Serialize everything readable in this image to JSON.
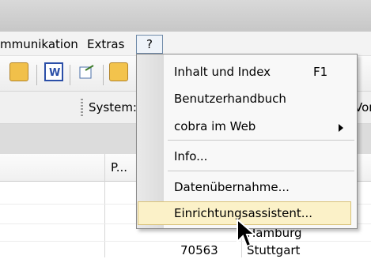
{
  "menubar": {
    "items": [
      "mmunikation",
      "Extras",
      "?"
    ]
  },
  "toolbar": {
    "system_label": "System:",
    "vor_label": "Vorl"
  },
  "grid": {
    "column_header": "P...",
    "rows": [
      {
        "plz": "",
        "ort": "Hamburg"
      },
      {
        "plz": "70563",
        "ort": "Stuttgart"
      }
    ]
  },
  "help_menu": {
    "items": [
      {
        "label": "Inhalt und Index",
        "shortcut": "F1"
      },
      {
        "label": "Benutzerhandbuch",
        "shortcut": ""
      },
      {
        "label": "cobra im Web",
        "shortcut": ""
      },
      {
        "label": "Info...",
        "shortcut": ""
      },
      {
        "label": "Datenübernahme...",
        "shortcut": ""
      },
      {
        "label": "Einrichtungsassistent...",
        "shortcut": ""
      }
    ]
  },
  "colors": {
    "highlight": "#fbf1c8",
    "highlight_border": "#d9c27a"
  }
}
